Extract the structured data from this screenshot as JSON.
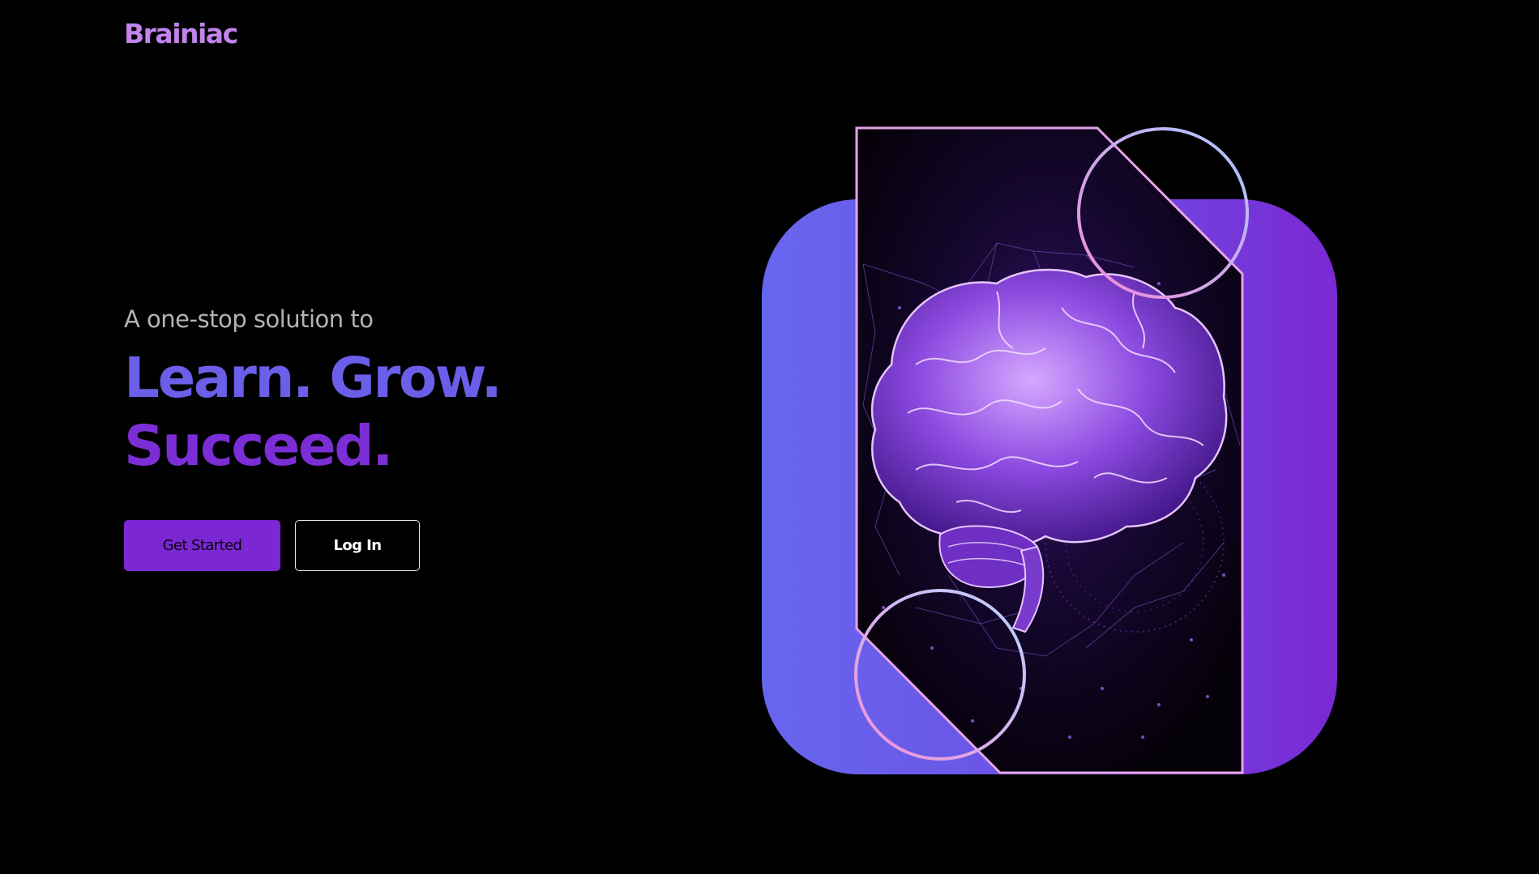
{
  "brand": {
    "name": "Brainiac"
  },
  "hero": {
    "kicker": "A one-stop solution to",
    "headline_line1": "Learn. Grow.",
    "headline_line2": "Succeed."
  },
  "actions": {
    "get_started_label": "Get Started",
    "login_label": "Log In"
  },
  "colors": {
    "background": "#000000",
    "brand": "#c184ec",
    "accent_blue": "#6b5ee9",
    "accent_purple": "#7b27d3",
    "frame_outline": "#e5a3e8"
  },
  "illustration": {
    "subject": "brain-illustration"
  }
}
